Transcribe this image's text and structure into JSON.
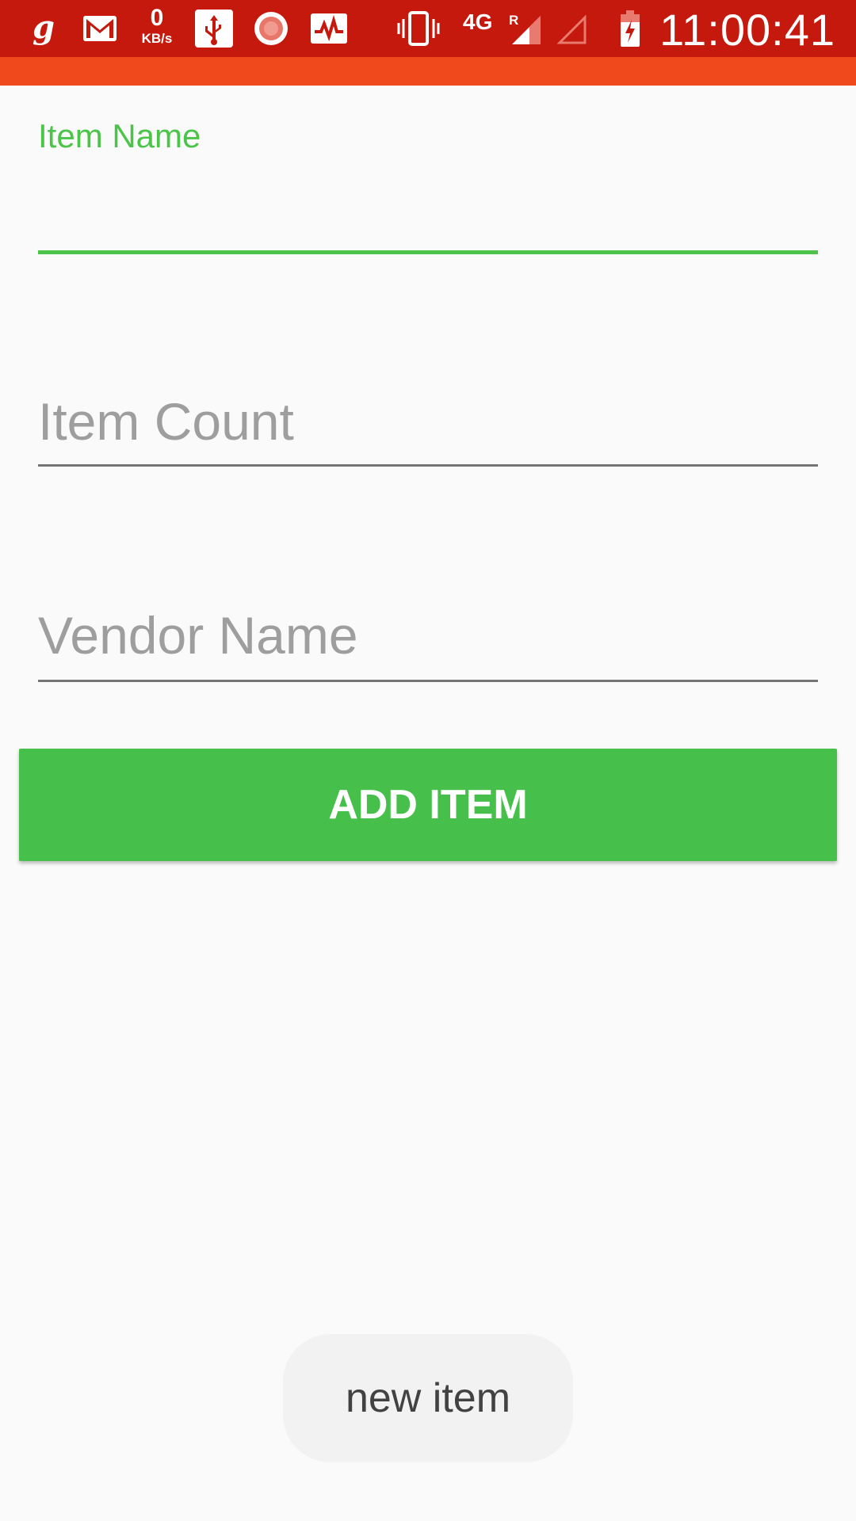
{
  "status_bar": {
    "background_color": "#c4190c",
    "notification_icons": [
      "g-app-icon",
      "gmail-icon",
      "usb-icon",
      "circle-app-icon",
      "activity-monitor-icon"
    ],
    "network_speed_value": "0",
    "network_speed_unit": "KB/s",
    "system_icons": [
      "vibrate-icon",
      "cell-signal-icon",
      "no-signal-icon",
      "battery-charging-icon"
    ],
    "network_type": "4G",
    "roaming_indicator": "R",
    "time": "11:00:41"
  },
  "app_bar": {
    "color": "#f04a1c"
  },
  "form": {
    "accent_color": "#4cc44a",
    "item_name": {
      "floating_label": "Item Name",
      "value": ""
    },
    "item_count": {
      "placeholder": "Item Count",
      "value": ""
    },
    "vendor_name": {
      "placeholder": "Vendor Name",
      "value": ""
    },
    "add_button_label": "ADD ITEM",
    "button_color": "#46c04a"
  },
  "toast": {
    "message": "new item"
  }
}
